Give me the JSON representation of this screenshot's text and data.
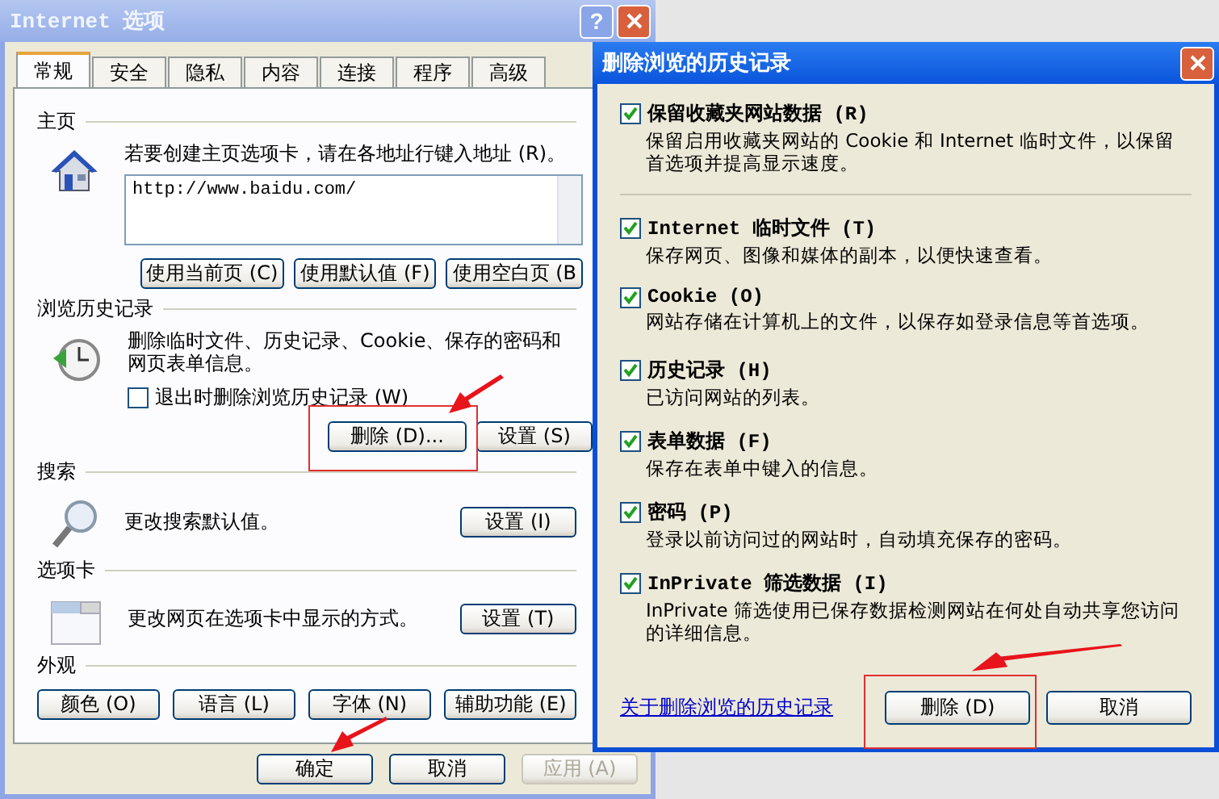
{
  "options_window": {
    "title": "Internet 选项",
    "help_button": "?",
    "tabs": [
      {
        "label": "常规",
        "selected": true
      },
      {
        "label": "安全",
        "selected": false
      },
      {
        "label": "隐私",
        "selected": false
      },
      {
        "label": "内容",
        "selected": false
      },
      {
        "label": "连接",
        "selected": false
      },
      {
        "label": "程序",
        "selected": false
      },
      {
        "label": "高级",
        "selected": false
      }
    ],
    "homepage": {
      "heading": "主页",
      "prompt": "若要创建主页选项卡，请在各地址行键入地址 (R)。",
      "address": "http://www.baidu.com/",
      "buttons": [
        "使用当前页 (C)",
        "使用默认值 (F)",
        "使用空白页 (B"
      ]
    },
    "history": {
      "heading": "浏览历史记录",
      "description": "删除临时文件、历史记录、Cookie、保存的密码和网页表单信息。",
      "exit_option": {
        "label": "退出时删除浏览历史记录 (W)",
        "checked": false
      },
      "buttons": [
        "删除 (D)...",
        "设置 (S)"
      ]
    },
    "search": {
      "heading": "搜索",
      "description": "更改搜索默认值。",
      "button": "设置 (I)"
    },
    "tab_settings": {
      "heading": "选项卡",
      "description": "更改网页在选项卡中显示的方式。",
      "button": "设置 (T)"
    },
    "appearance": {
      "heading": "外观",
      "buttons": [
        "颜色 (O)",
        "语言 (L)",
        "字体 (N)",
        "辅助功能 (E)"
      ]
    },
    "footer": [
      {
        "label": "确定",
        "disabled": false
      },
      {
        "label": "取消",
        "disabled": false
      },
      {
        "label": "应用 (A)",
        "disabled": true
      }
    ]
  },
  "delete_window": {
    "title": "删除浏览的历史记录",
    "items": [
      {
        "label": "保留收藏夹网站数据 (R)",
        "description": "保留启用收藏夹网站的 Cookie 和 Internet 临时文件，以保留首选项并提高显示速度。",
        "checked": true
      },
      {
        "label": "Internet 临时文件 (T)",
        "description": "保存网页、图像和媒体的副本，以便快速查看。",
        "checked": true
      },
      {
        "label": "Cookie (O)",
        "description": "网站存储在计算机上的文件，以保存如登录信息等首选项。",
        "checked": true
      },
      {
        "label": "历史记录 (H)",
        "description": "已访问网站的列表。",
        "checked": true
      },
      {
        "label": "表单数据 (F)",
        "description": "保存在表单中键入的信息。",
        "checked": true
      },
      {
        "label": "密码 (P)",
        "description": "登录以前访问过的网站时，自动填充保存的密码。",
        "checked": true
      },
      {
        "label": "InPrivate 筛选数据 (I)",
        "description": "InPrivate 筛选使用已保存数据检测网站在何处自动共享您访问的详细信息。",
        "checked": true
      }
    ],
    "link": "关于删除浏览的历史记录",
    "buttons": [
      "删除 (D)",
      "取消"
    ]
  }
}
